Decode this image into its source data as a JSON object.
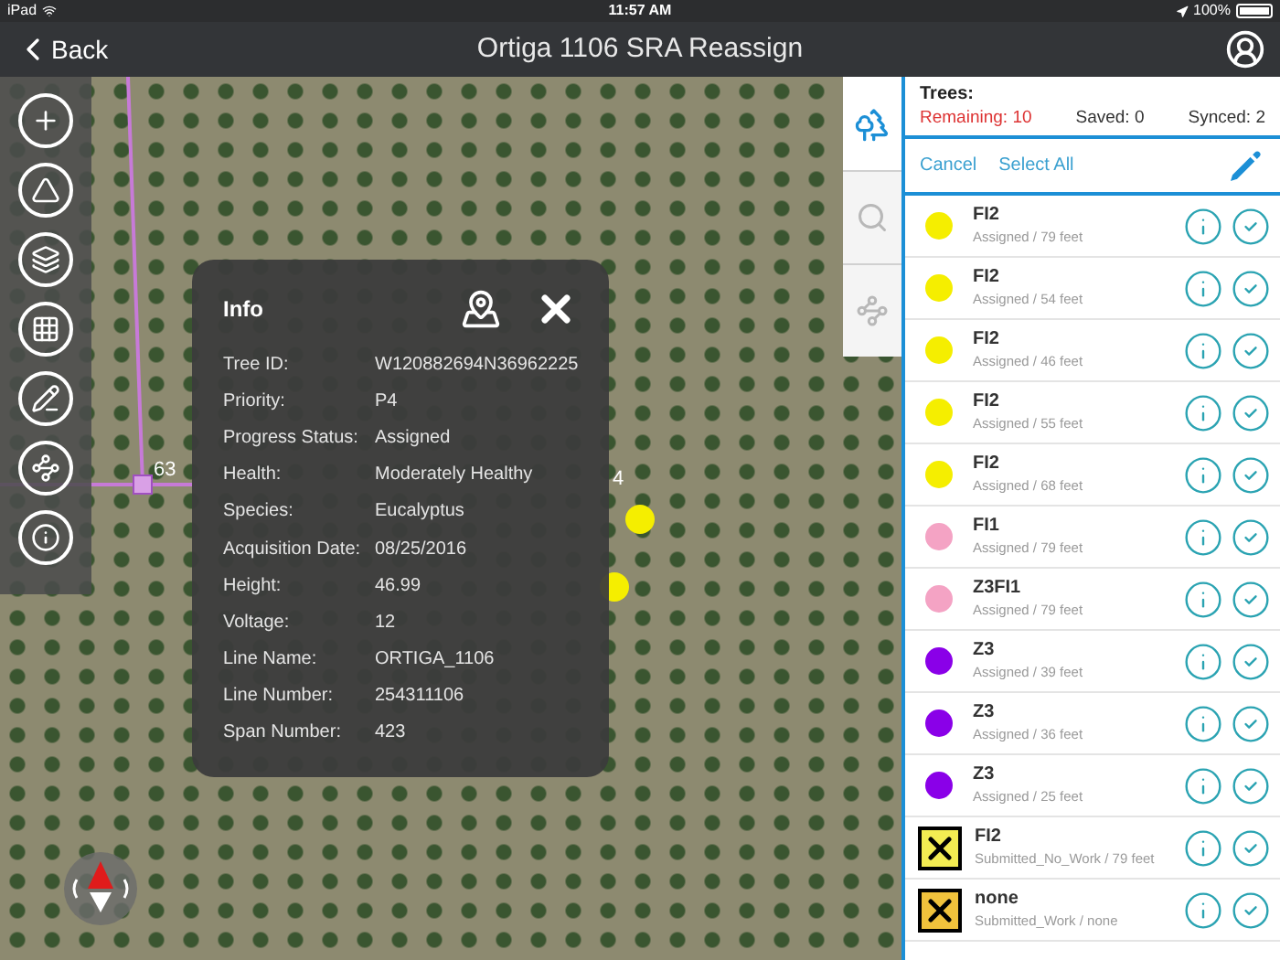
{
  "status_bar": {
    "device": "iPad",
    "time": "11:57 AM",
    "battery": "100%"
  },
  "nav": {
    "back": "Back",
    "title": "Ortiga 1106 SRA Reassign"
  },
  "map": {
    "labels": [
      "63",
      "4"
    ]
  },
  "info": {
    "title": "Info",
    "fields": [
      {
        "label": "Tree ID:",
        "value": "W120882694N36962225"
      },
      {
        "label": "Priority:",
        "value": "P4"
      },
      {
        "label": "Progress Status:",
        "value": "Assigned"
      },
      {
        "label": "Health:",
        "value": "Moderately Healthy"
      },
      {
        "label": "Species:",
        "value": "Eucalyptus"
      },
      {
        "label": "Acquisition Date:",
        "value": "08/25/2016"
      },
      {
        "label": "Height:",
        "value": "46.99"
      },
      {
        "label": "Voltage:",
        "value": "12"
      },
      {
        "label": "Line Name:",
        "value": "ORTIGA_1106"
      },
      {
        "label": "Line Number:",
        "value": "254311106"
      },
      {
        "label": "Span Number:",
        "value": "423"
      }
    ]
  },
  "side_tabs": [
    {
      "kind": "tree",
      "selected": true
    },
    {
      "kind": "search",
      "selected": false
    },
    {
      "kind": "route",
      "selected": false
    }
  ],
  "panel": {
    "heading": "Trees:",
    "counts": [
      {
        "text": "Remaining: 10",
        "kind": "alert"
      },
      {
        "text": "Saved: 0",
        "kind": "normal"
      },
      {
        "text": "Synced: 2",
        "kind": "normal"
      }
    ],
    "actions": [
      "Cancel",
      "Select All"
    ],
    "trees": [
      {
        "name": "FI2",
        "detail": "Assigned / 79 feet",
        "kind": "dot",
        "color": "#f5ee00"
      },
      {
        "name": "FI2",
        "detail": "Assigned / 54 feet",
        "kind": "dot",
        "color": "#f5ee00"
      },
      {
        "name": "FI2",
        "detail": "Assigned / 46 feet",
        "kind": "dot",
        "color": "#f5ee00"
      },
      {
        "name": "FI2",
        "detail": "Assigned / 55 feet",
        "kind": "dot",
        "color": "#f5ee00"
      },
      {
        "name": "FI2",
        "detail": "Assigned / 68 feet",
        "kind": "dot",
        "color": "#f5ee00"
      },
      {
        "name": "FI1",
        "detail": "Assigned / 79 feet",
        "kind": "dot",
        "color": "#f4a3c4"
      },
      {
        "name": "Z3FI1",
        "detail": "Assigned / 79 feet",
        "kind": "dot",
        "color": "#f4a3c4"
      },
      {
        "name": "Z3",
        "detail": "Assigned / 39 feet",
        "kind": "dot",
        "color": "#8a00e8"
      },
      {
        "name": "Z3",
        "detail": "Assigned / 36 feet",
        "kind": "dot",
        "color": "#8a00e8"
      },
      {
        "name": "Z3",
        "detail": "Assigned / 25 feet",
        "kind": "dot",
        "color": "#8a00e8"
      },
      {
        "name": "FI2",
        "detail": "Submitted_No_Work / 79 feet",
        "kind": "crossed",
        "color": "#f3ec52"
      },
      {
        "name": "none",
        "detail": "Submitted_Work / none",
        "kind": "crossed",
        "color": "#f0c23c"
      }
    ]
  }
}
